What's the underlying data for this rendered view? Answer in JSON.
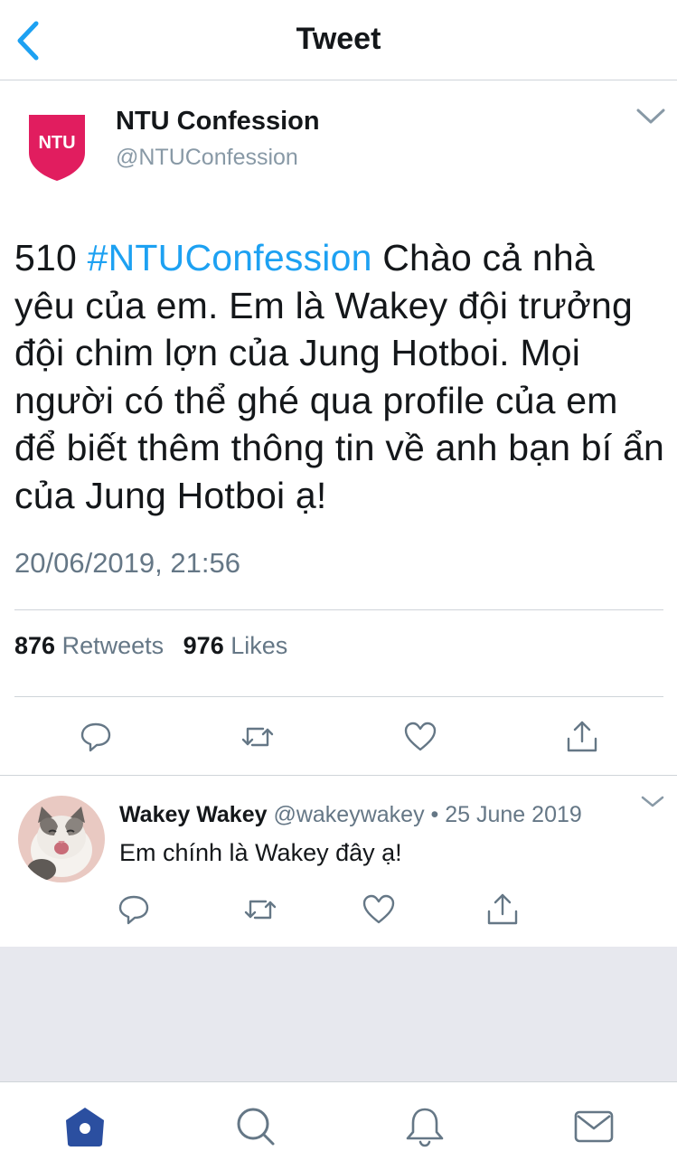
{
  "nav": {
    "title": "Tweet",
    "back_icon": "chevron-left-icon"
  },
  "tweet": {
    "author_name": "NTU Confession",
    "author_handle": "@NTUConfession",
    "avatar_text": "NTU",
    "text_prefix": "510 ",
    "hashtag": "#NTUConfession",
    "text_body": " Chào cả nhà yêu của em. Em là Wakey đội trưởng đội chim lợn của Jung Hotboi. Mọi người có thể ghé qua profile của em để biết thêm thông tin về anh bạn bí ẩn của Jung Hotboi ạ!",
    "timestamp": "20/06/2019, 21:56",
    "retweets_count": "876",
    "retweets_label": "Retweets",
    "likes_count": "976",
    "likes_label": "Likes"
  },
  "reply": {
    "author_name": "Wakey Wakey",
    "author_handle": "@wakeywakey",
    "separator": "•",
    "date": "25 June 2019",
    "text": "Em chính là Wakey đây ạ!"
  },
  "tabs": [
    "home-icon",
    "search-icon",
    "notifications-icon",
    "messages-icon"
  ],
  "colors": {
    "accent": "#1da1f2",
    "brand_ntu": "#e11d5f",
    "text_primary": "#14171a",
    "text_secondary": "#657786",
    "tab_active": "#2b4fa0"
  }
}
